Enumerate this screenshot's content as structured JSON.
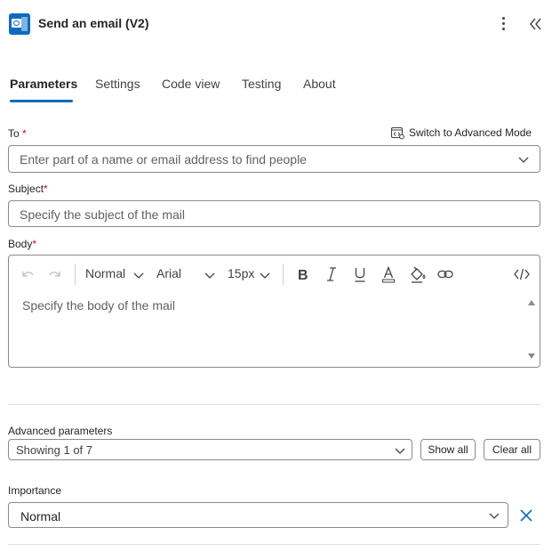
{
  "header": {
    "title": "Send an email (V2)",
    "app_icon": "outlook-icon",
    "more_icon": "more-vertical-icon",
    "collapse_icon": "collapse-double-chevron-icon"
  },
  "tabs": [
    {
      "label": "Parameters",
      "active": true
    },
    {
      "label": "Settings",
      "active": false
    },
    {
      "label": "Code view",
      "active": false
    },
    {
      "label": "Testing",
      "active": false
    },
    {
      "label": "About",
      "active": false
    }
  ],
  "to": {
    "label": "To",
    "required_mark": "*",
    "placeholder": "Enter part of a name or email address to find people",
    "advanced_mode_label": "Switch to Advanced Mode"
  },
  "subject": {
    "label": "Subject",
    "required_mark": "*",
    "placeholder": "Specify the subject of the mail"
  },
  "body": {
    "label": "Body",
    "required_mark": "*",
    "placeholder": "Specify the body of the mail",
    "toolbar": {
      "format": "Normal",
      "font": "Arial",
      "size": "15px"
    }
  },
  "advanced": {
    "label": "Advanced parameters",
    "value": "Showing 1 of 7",
    "show_all": "Show all",
    "clear_all": "Clear all"
  },
  "importance": {
    "label": "Importance",
    "value": "Normal"
  },
  "colors": {
    "accent": "#0f6cbd",
    "required": "#c50f1f",
    "border": "#8a8a8a"
  }
}
